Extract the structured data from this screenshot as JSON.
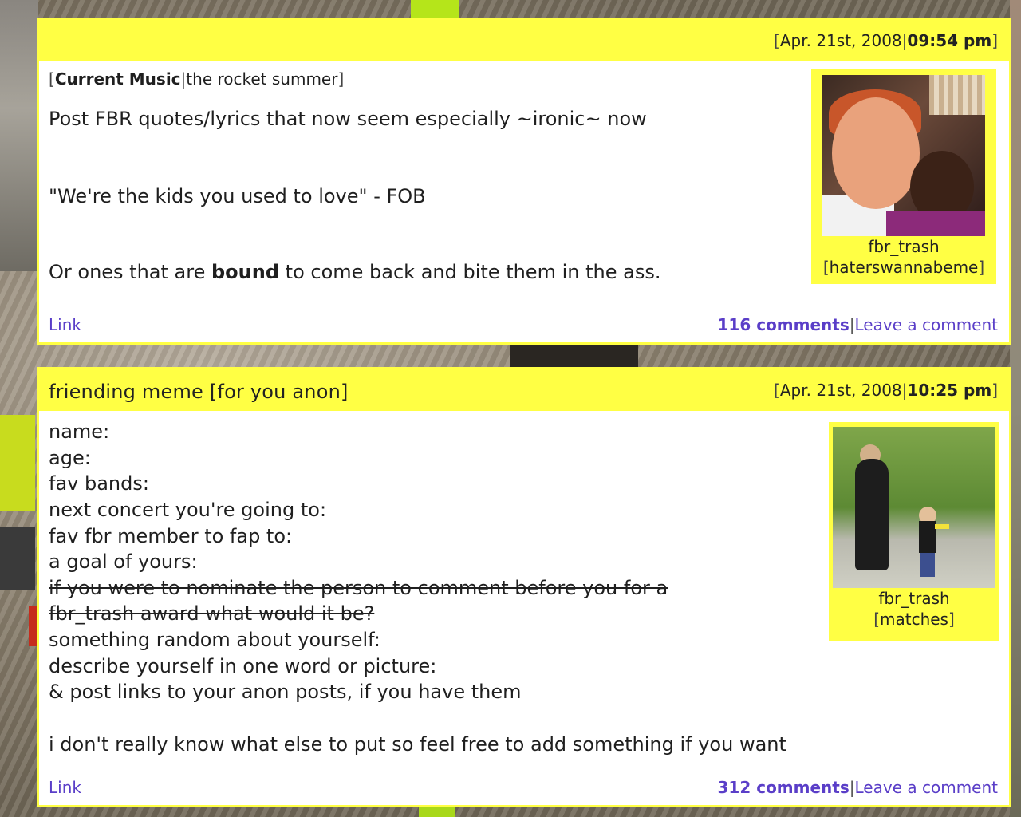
{
  "entries": [
    {
      "subject": "",
      "date": "Apr. 21st, 2008",
      "time": "09:54 pm",
      "current_music_label": "Current Music",
      "current_music_value": "the rocket summer",
      "lines": [
        "Post FBR quotes/lyrics that now seem especially ~ironic~ now",
        "\"We're the kids you used to love\" - FOB"
      ],
      "last_line_before": "Or ones that are ",
      "last_line_bold": "bound",
      "last_line_after": " to come back and bite them in the ass.",
      "userpic": {
        "username": "fbr_trash",
        "keyword": "haterswannabeme"
      },
      "link_label": "Link",
      "comments_label": "116 comments",
      "leave_label": "Leave a comment"
    },
    {
      "subject": "friending meme [for you anon]",
      "date": "Apr. 21st, 2008",
      "time": "10:25 pm",
      "lines": [
        "name:",
        "age:",
        "fav bands:",
        "next concert you're going to:",
        "fav fbr member to fap to:",
        "a goal of yours:"
      ],
      "struck_lines": [
        "if you were to nominate the person to comment before you for a",
        "fbr_trash award what would it be?"
      ],
      "more_lines": [
        "something random about yourself:",
        "describe yourself in one word or picture:",
        "& post links to your anon posts, if you have them"
      ],
      "closing": "i don't really know what else to put so feel free to add something if you want",
      "userpic": {
        "username": "fbr_trash",
        "keyword": "matches"
      },
      "link_label": "Link",
      "comments_label": "312 comments",
      "leave_label": "Leave a comment"
    }
  ],
  "colors": {
    "entry_bg": "#ffff44",
    "link": "#5a3ec8"
  }
}
